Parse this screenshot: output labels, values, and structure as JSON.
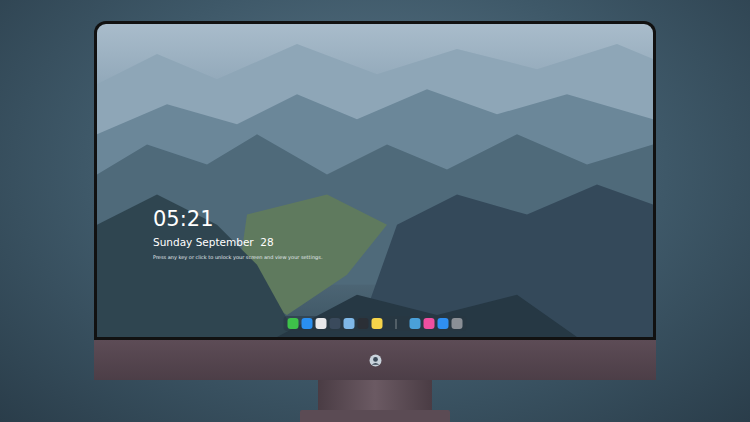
{
  "lock_screen": {
    "time": "05:21",
    "date": "Sunday September  28",
    "hint": "Press any key or click to unlock your screen and view your settings."
  },
  "dock": {
    "apps": [
      {
        "color": "#3ec24a"
      },
      {
        "color": "#2a8ff0"
      },
      {
        "color": "#e8e8ea"
      },
      {
        "color": "#3a4a5c"
      },
      {
        "color": "#7fb8e8"
      },
      {
        "color": "#2b2f36"
      },
      {
        "color": "#f6d44a"
      },
      {
        "color": "#4aa0d8"
      },
      {
        "color": "#f04fa0"
      },
      {
        "color": "#2f8ff2"
      },
      {
        "color": "#8a8f96"
      }
    ],
    "separator_after": 7
  }
}
